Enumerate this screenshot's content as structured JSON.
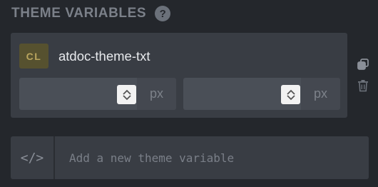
{
  "header": {
    "title": "THEME VARIABLES",
    "help_glyph": "?"
  },
  "variable": {
    "type_badge": "CL",
    "name": "atdoc-theme-txt",
    "fields": [
      {
        "value": "",
        "unit": "px"
      },
      {
        "value": "",
        "unit": "px"
      }
    ]
  },
  "actions": {
    "copy_icon": "copy-icon",
    "delete_icon": "trash-icon"
  },
  "add_variable": {
    "icon_glyph": "</>",
    "placeholder": "Add a new theme variable"
  },
  "colors": {
    "background": "#24272c",
    "card": "#393d44",
    "badge_bg": "#56512f",
    "badge_text": "#b9a55e"
  }
}
